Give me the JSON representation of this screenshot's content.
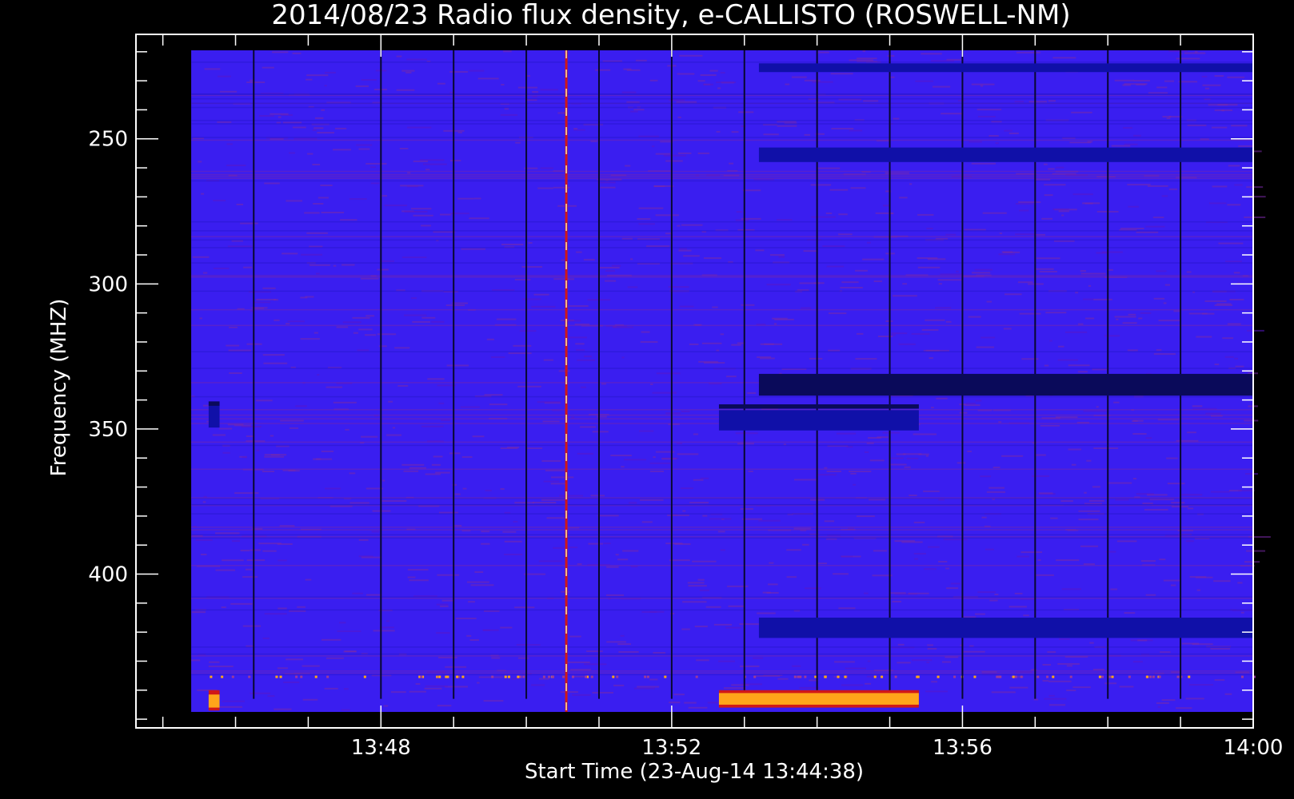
{
  "chart_data": {
    "type": "heatmap",
    "title": "2014/08/23  Radio flux density, e-CALLISTO (ROSWELL-NM)",
    "xlabel": "Start Time (23-Aug-14 13:44:38)",
    "ylabel": "Frequency (MHZ)",
    "x_tick_labels": [
      "13:48",
      "13:52",
      "13:56",
      "14:00"
    ],
    "x_tick_minutes": [
      228,
      232,
      236,
      240
    ],
    "xlim_minutes": [
      224.63,
      240.0
    ],
    "data_extent_minutes": [
      225.39,
      240.0
    ],
    "y_tick_labels": [
      "250",
      "300",
      "350",
      "400"
    ],
    "y_tick_values": [
      250,
      300,
      350,
      400
    ],
    "ylim": [
      214,
      453
    ],
    "data_extent_freq": [
      219.5,
      447.5
    ],
    "y_inverted": true,
    "minor_y_step": 10,
    "minor_x_step_minutes": 1,
    "colormap": "blue-red-yellow",
    "colors": {
      "background": "#000000",
      "base": "#3a1ef0",
      "dark": "#0a0a5a",
      "deep_blue": "#1010a8",
      "red": "#d01818",
      "orange": "#ffa51a",
      "yellow": "#ffe9a0",
      "axis": "#ffffff"
    },
    "dark_gaps_minutes": [
      226.25,
      228.0,
      229.0,
      230.0,
      231.0,
      232.0,
      233.0,
      234.0,
      235.0,
      236.0,
      237.0,
      238.0,
      239.0
    ],
    "features": [
      {
        "kind": "burst_line",
        "t": 230.55,
        "f0": 219.5,
        "f1": 447.5,
        "color": "yellow"
      },
      {
        "kind": "band",
        "t0": 232.65,
        "t1": 235.4,
        "f0": 341.5,
        "f1": 343.0,
        "color": "dark"
      },
      {
        "kind": "band",
        "t0": 232.65,
        "t1": 235.4,
        "f0": 343.5,
        "f1": 350.5,
        "color": "deep_blue"
      },
      {
        "kind": "band",
        "t0": 233.2,
        "t1": 240.0,
        "f0": 331.0,
        "f1": 338.5,
        "color": "dark"
      },
      {
        "kind": "band",
        "t0": 233.2,
        "t1": 240.0,
        "f0": 224.0,
        "f1": 227.0,
        "color": "deep_blue"
      },
      {
        "kind": "band",
        "t0": 233.2,
        "t1": 240.0,
        "f0": 253.0,
        "f1": 258.0,
        "color": "deep_blue"
      },
      {
        "kind": "band",
        "t0": 233.2,
        "t1": 240.0,
        "f0": 415.0,
        "f1": 422.0,
        "color": "deep_blue"
      },
      {
        "kind": "band",
        "t0": 232.65,
        "t1": 235.4,
        "f0": 440.0,
        "f1": 446.0,
        "color": "red"
      },
      {
        "kind": "band",
        "t0": 232.65,
        "t1": 235.4,
        "f0": 441.0,
        "f1": 445.0,
        "color": "orange"
      },
      {
        "kind": "band",
        "t0": 225.63,
        "t1": 225.78,
        "f0": 440.0,
        "f1": 447.0,
        "color": "red"
      },
      {
        "kind": "band",
        "t0": 225.63,
        "t1": 225.78,
        "f0": 441.5,
        "f1": 446.0,
        "color": "orange"
      },
      {
        "kind": "band",
        "t0": 225.63,
        "t1": 225.78,
        "f0": 340.5,
        "f1": 349.5,
        "color": "deep_blue"
      },
      {
        "kind": "band",
        "t0": 225.63,
        "t1": 225.78,
        "f0": 340.5,
        "f1": 342.0,
        "color": "dark"
      }
    ]
  }
}
